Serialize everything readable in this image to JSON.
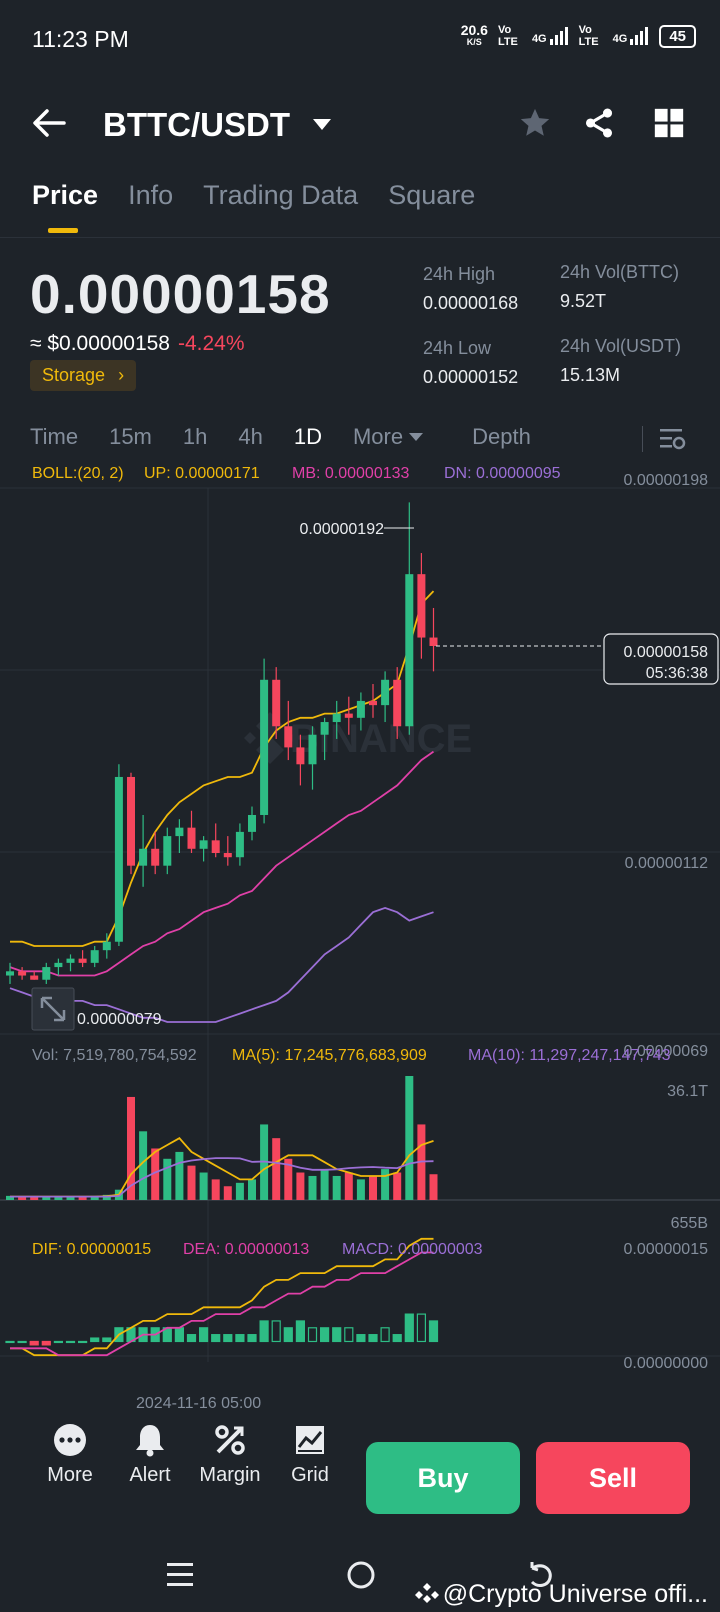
{
  "status_bar": {
    "time": "11:23 PM",
    "speed": "20.6",
    "speed_unit": "K/S",
    "net1": "Vo LTE",
    "net2": "4G",
    "net3": "Vo LTE",
    "net4": "4G",
    "battery": "45"
  },
  "header": {
    "pair": "BTTC/USDT"
  },
  "tabs": [
    {
      "label": "Price"
    },
    {
      "label": "Info"
    },
    {
      "label": "Trading Data"
    },
    {
      "label": "Square"
    }
  ],
  "price": {
    "last": "0.00000158",
    "usd": "≈ $0.00000158",
    "change": "-4.24%",
    "tag": "Storage"
  },
  "stats": {
    "high_label": "24h High",
    "high": "0.00000168",
    "low_label": "24h Low",
    "low": "0.00000152",
    "vol_base_label": "24h Vol(BTTC)",
    "vol_base": "9.52T",
    "vol_quote_label": "24h Vol(USDT)",
    "vol_quote": "15.13M"
  },
  "intervals": [
    {
      "label": "Time"
    },
    {
      "label": "15m"
    },
    {
      "label": "1h"
    },
    {
      "label": "4h"
    },
    {
      "label": "1D"
    },
    {
      "label": "More"
    },
    {
      "label": "Depth"
    }
  ],
  "indicators": {
    "boll": "BOLL:(20, 2)",
    "up": "UP: 0.00000171",
    "mb": "MB: 0.00000133",
    "dn": "DN: 0.00000095",
    "vol": "Vol: 7,519,780,754,592",
    "ma5": "MA(5): 17,245,776,683,909",
    "ma10": "MA(10): 11,297,247,147,743",
    "dif": "DIF: 0.00000015",
    "dea": "DEA: 0.00000013",
    "macd": "MACD: 0.00000003"
  },
  "axes": {
    "price_top": "0.00000198",
    "price_mid": "0.00000112",
    "price_bot": "0.00000069",
    "vol_top": "36.1T",
    "vol_bot": "655B",
    "macd_top": "0.00000015",
    "macd_zero": "0.00000000",
    "date": "2024-11-16 05:00"
  },
  "chart_marks": {
    "high": "0.00000192",
    "low": "0.00000079",
    "current": "0.00000158",
    "countdown": "05:36:38",
    "watermark": "BINANCE"
  },
  "colors": {
    "up": "#2ebd85",
    "down": "#f6465d",
    "accent": "#f0b90b",
    "boll_mb": "#e040a8",
    "boll_dn": "#9b6fd6"
  },
  "bottom": {
    "more": "More",
    "alert": "Alert",
    "margin": "Margin",
    "grid": "Grid",
    "buy": "Buy",
    "sell": "Sell"
  },
  "footer": {
    "handle": "@Crypto Universe offi..."
  },
  "chart_data": {
    "type": "candlestick",
    "interval": "1D",
    "ylim": [
      6.9e-07,
      1.98e-06
    ],
    "candles": [
      {
        "o": 8e-07,
        "h": 8.3e-07,
        "l": 7.8e-07,
        "c": 8.1e-07
      },
      {
        "o": 8.1e-07,
        "h": 8.2e-07,
        "l": 7.9e-07,
        "c": 8e-07
      },
      {
        "o": 8e-07,
        "h": 8.1e-07,
        "l": 7.9e-07,
        "c": 7.9e-07
      },
      {
        "o": 7.9e-07,
        "h": 8.3e-07,
        "l": 7.8e-07,
        "c": 8.2e-07
      },
      {
        "o": 8.2e-07,
        "h": 8.4e-07,
        "l": 8e-07,
        "c": 8.3e-07
      },
      {
        "o": 8.3e-07,
        "h": 8.5e-07,
        "l": 8.1e-07,
        "c": 8.4e-07
      },
      {
        "o": 8.4e-07,
        "h": 8.6e-07,
        "l": 8.2e-07,
        "c": 8.3e-07
      },
      {
        "o": 8.3e-07,
        "h": 8.7e-07,
        "l": 8.2e-07,
        "c": 8.6e-07
      },
      {
        "o": 8.6e-07,
        "h": 9e-07,
        "l": 8.4e-07,
        "c": 8.8e-07
      },
      {
        "o": 8.8e-07,
        "h": 1.3e-06,
        "l": 8.7e-07,
        "c": 1.27e-06
      },
      {
        "o": 1.27e-06,
        "h": 1.28e-06,
        "l": 1.04e-06,
        "c": 1.06e-06
      },
      {
        "o": 1.06e-06,
        "h": 1.18e-06,
        "l": 1.01e-06,
        "c": 1.1e-06
      },
      {
        "o": 1.1e-06,
        "h": 1.14e-06,
        "l": 1.04e-06,
        "c": 1.06e-06
      },
      {
        "o": 1.06e-06,
        "h": 1.15e-06,
        "l": 1.04e-06,
        "c": 1.13e-06
      },
      {
        "o": 1.13e-06,
        "h": 1.17e-06,
        "l": 1.09e-06,
        "c": 1.15e-06
      },
      {
        "o": 1.15e-06,
        "h": 1.19e-06,
        "l": 1.09e-06,
        "c": 1.1e-06
      },
      {
        "o": 1.1e-06,
        "h": 1.13e-06,
        "l": 1.07e-06,
        "c": 1.12e-06
      },
      {
        "o": 1.12e-06,
        "h": 1.16e-06,
        "l": 1.08e-06,
        "c": 1.09e-06
      },
      {
        "o": 1.09e-06,
        "h": 1.13e-06,
        "l": 1.06e-06,
        "c": 1.08e-06
      },
      {
        "o": 1.08e-06,
        "h": 1.16e-06,
        "l": 1.06e-06,
        "c": 1.14e-06
      },
      {
        "o": 1.14e-06,
        "h": 1.2e-06,
        "l": 1.12e-06,
        "c": 1.18e-06
      },
      {
        "o": 1.18e-06,
        "h": 1.55e-06,
        "l": 1.16e-06,
        "c": 1.5e-06
      },
      {
        "o": 1.5e-06,
        "h": 1.53e-06,
        "l": 1.36e-06,
        "c": 1.39e-06
      },
      {
        "o": 1.39e-06,
        "h": 1.45e-06,
        "l": 1.31e-06,
        "c": 1.34e-06
      },
      {
        "o": 1.34e-06,
        "h": 1.37e-06,
        "l": 1.25e-06,
        "c": 1.3e-06
      },
      {
        "o": 1.3e-06,
        "h": 1.39e-06,
        "l": 1.24e-06,
        "c": 1.37e-06
      },
      {
        "o": 1.37e-06,
        "h": 1.41e-06,
        "l": 1.31e-06,
        "c": 1.4e-06
      },
      {
        "o": 1.4e-06,
        "h": 1.45e-06,
        "l": 1.36e-06,
        "c": 1.42e-06
      },
      {
        "o": 1.42e-06,
        "h": 1.46e-06,
        "l": 1.37e-06,
        "c": 1.41e-06
      },
      {
        "o": 1.41e-06,
        "h": 1.47e-06,
        "l": 1.38e-06,
        "c": 1.45e-06
      },
      {
        "o": 1.45e-06,
        "h": 1.49e-06,
        "l": 1.41e-06,
        "c": 1.44e-06
      },
      {
        "o": 1.44e-06,
        "h": 1.52e-06,
        "l": 1.4e-06,
        "c": 1.5e-06
      },
      {
        "o": 1.5e-06,
        "h": 1.53e-06,
        "l": 1.36e-06,
        "c": 1.39e-06
      },
      {
        "o": 1.39e-06,
        "h": 1.92e-06,
        "l": 1.37e-06,
        "c": 1.75e-06
      },
      {
        "o": 1.75e-06,
        "h": 1.8e-06,
        "l": 1.55e-06,
        "c": 1.6e-06
      },
      {
        "o": 1.6e-06,
        "h": 1.67e-06,
        "l": 1.52e-06,
        "c": 1.58e-06
      }
    ],
    "boll_up": [
      8.8e-07,
      8.8e-07,
      8.7e-07,
      8.7e-07,
      8.7e-07,
      8.7e-07,
      8.7e-07,
      8.8e-07,
      8.8e-07,
      9.4e-07,
      1.02e-06,
      1.09e-06,
      1.14e-06,
      1.18e-06,
      1.21e-06,
      1.23e-06,
      1.25e-06,
      1.26e-06,
      1.27e-06,
      1.27e-06,
      1.28e-06,
      1.34e-06,
      1.38e-06,
      1.4e-06,
      1.41e-06,
      1.41e-06,
      1.42e-06,
      1.42e-06,
      1.43e-06,
      1.44e-06,
      1.45e-06,
      1.47e-06,
      1.49e-06,
      1.58e-06,
      1.68e-06,
      1.71e-06
    ],
    "boll_mb": [
      8.2e-07,
      8.1e-07,
      8.1e-07,
      8.1e-07,
      8e-07,
      8e-07,
      8e-07,
      8e-07,
      8.1e-07,
      8.3e-07,
      8.5e-07,
      8.7e-07,
      8.8e-07,
      9e-07,
      9.1e-07,
      9.3e-07,
      9.5e-07,
      9.6e-07,
      9.7e-07,
      9.9e-07,
      1e-06,
      1.03e-06,
      1.06e-06,
      1.08e-06,
      1.1e-06,
      1.12e-06,
      1.14e-06,
      1.16e-06,
      1.18e-06,
      1.19e-06,
      1.21e-06,
      1.23e-06,
      1.25e-06,
      1.28e-06,
      1.31e-06,
      1.33e-06
    ],
    "boll_dn": [
      7.7e-07,
      7.6e-07,
      7.5e-07,
      7.5e-07,
      7.4e-07,
      7.4e-07,
      7.4e-07,
      7.3e-07,
      7.3e-07,
      7.2e-07,
      7.1e-07,
      7e-07,
      7e-07,
      6.9e-07,
      6.9e-07,
      6.9e-07,
      6.9e-07,
      6.9e-07,
      7e-07,
      7.1e-07,
      7.2e-07,
      7.3e-07,
      7.4e-07,
      7.6e-07,
      7.9e-07,
      8.2e-07,
      8.5e-07,
      8.7e-07,
      8.9e-07,
      9.2e-07,
      9.5e-07,
      9.6e-07,
      9.5e-07,
      9.3e-07,
      9.4e-07,
      9.5e-07
    ],
    "volume": [
      1.2,
      1.0,
      0.9,
      1.1,
      1.0,
      0.9,
      1.0,
      1.2,
      1.5,
      3.0,
      30,
      20,
      15,
      12,
      14,
      10,
      8,
      6,
      4,
      5,
      6,
      22,
      18,
      12,
      8,
      7,
      9,
      7,
      8,
      6,
      7,
      9,
      8,
      36.1,
      22,
      7.5
    ],
    "vol_ylim": [
      0,
      36.1
    ],
    "vol_ma5": [
      1.0,
      1.0,
      1.0,
      1.0,
      1.0,
      1.0,
      1.0,
      1.0,
      1.1,
      1.5,
      7.5,
      11,
      14,
      16,
      18,
      14,
      12,
      10,
      8,
      6,
      6,
      9,
      11,
      13,
      13,
      13,
      11,
      9,
      8,
      7,
      7,
      7,
      8,
      13,
      16,
      17.2
    ],
    "vol_ma10": [
      1.0,
      1.0,
      1.0,
      1.0,
      1.0,
      1.0,
      1.0,
      1.0,
      1.0,
      1.2,
      4.2,
      6.3,
      8,
      9.4,
      10.8,
      11.5,
      11.9,
      12.2,
      12.2,
      12.1,
      11.1,
      11.2,
      10.8,
      10.3,
      9.4,
      8.8,
      8.8,
      8.9,
      9.3,
      9.5,
      9.6,
      9.4,
      9.3,
      10.6,
      11.2,
      11.3
    ],
    "macd_dif": [
      -1e-08,
      -1e-08,
      -2e-08,
      -2e-08,
      -2e-08,
      -2e-08,
      -2e-08,
      -1e-08,
      -1e-08,
      1e-08,
      2e-08,
      3e-08,
      3e-08,
      4e-08,
      4e-08,
      4e-08,
      5e-08,
      5e-08,
      5e-08,
      5e-08,
      6e-08,
      8e-08,
      9e-08,
      9e-08,
      1e-07,
      1e-07,
      1e-07,
      1.1e-07,
      1.1e-07,
      1.1e-07,
      1.1e-07,
      1.2e-07,
      1.2e-07,
      1.4e-07,
      1.5e-07,
      1.5e-07
    ],
    "macd_dea": [
      -1e-08,
      -1e-08,
      -1e-08,
      -1e-08,
      -2e-08,
      -2e-08,
      -2e-08,
      -2e-08,
      -2e-08,
      -1e-08,
      0.0,
      1e-08,
      1e-08,
      2e-08,
      2e-08,
      3e-08,
      3e-08,
      4e-08,
      4e-08,
      4e-08,
      5e-08,
      5e-08,
      6e-08,
      7e-08,
      7e-08,
      8e-08,
      8e-08,
      9e-08,
      9e-08,
      1e-07,
      1e-07,
      1e-07,
      1.1e-07,
      1.2e-07,
      1.3e-07,
      1.3e-07
    ],
    "macd_hist": [
      0,
      0,
      -5e-09,
      -5e-09,
      0,
      0,
      0,
      5e-09,
      5e-09,
      2e-08,
      2e-08,
      2e-08,
      2e-08,
      2e-08,
      2e-08,
      1e-08,
      2e-08,
      1e-08,
      1e-08,
      1e-08,
      1e-08,
      3e-08,
      3e-08,
      2e-08,
      3e-08,
      2e-08,
      2e-08,
      2e-08,
      2e-08,
      1e-08,
      1e-08,
      2e-08,
      1e-08,
      4e-08,
      4e-08,
      3e-08
    ],
    "macd_ylim": [
      -3e-08,
      1.6e-07
    ]
  }
}
